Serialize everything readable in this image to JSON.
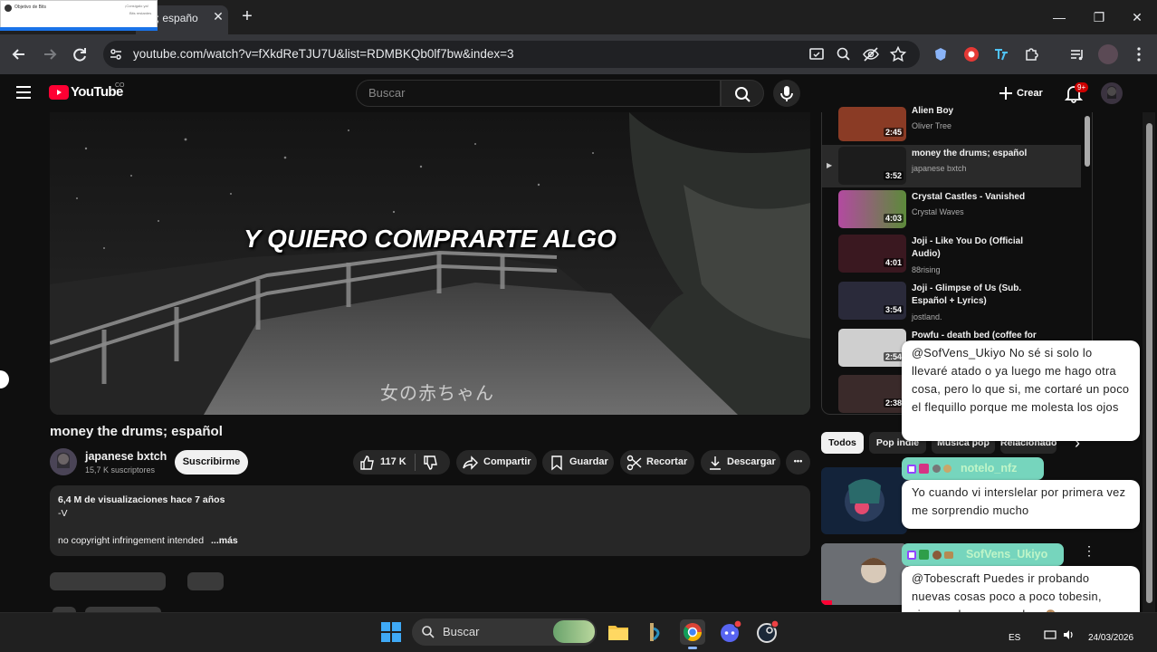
{
  "browser": {
    "tab_title": "ns; españo",
    "popup": {
      "title": "Objetivo de Bits",
      "r1": "¡Consígalo ya!",
      "r2": "Bits restantes"
    },
    "url": "youtube.com/watch?v=fXkdReTJU7U&list=RDMBKQb0lf7bw&index=3",
    "tab_close_glyph": "✕",
    "new_tab_glyph": "+",
    "window_controls": {
      "minimize": "—",
      "restore": "❐",
      "close": "✕"
    }
  },
  "header": {
    "logo_text": "YouTube",
    "country": "CO",
    "search_placeholder": "Buscar",
    "create_label": "Crear",
    "notifications_badge": "9+"
  },
  "player": {
    "subtitle": "Y QUIERO COMPRARTE ALGO",
    "jp_caption": "女の赤ちゃん"
  },
  "video": {
    "title": "money the drums; español",
    "channel": "japanese bxtch",
    "subscribers": "15,7 K suscriptores",
    "subscribe_label": "Suscribirme",
    "likes": "117 K",
    "share_label": "Compartir",
    "save_label": "Guardar",
    "clip_label": "Recortar",
    "download_label": "Descargar",
    "more_glyph": "•••"
  },
  "description": {
    "stats": "6,4 M de visualizaciones  hace 7 años",
    "line2": "-V",
    "line3": "no copyright infringement intended",
    "more": "...más"
  },
  "playlist": {
    "items": [
      {
        "title": "Alien Boy",
        "channel": "Oliver Tree",
        "duration": "2:45",
        "thumb": "#8a3b25"
      },
      {
        "title": "money the drums; español",
        "channel": "japanese bxtch",
        "duration": "3:52",
        "thumb": "#1c1c1c",
        "playing_glyph": "▶"
      },
      {
        "title": "Crystal Castles - Vanished",
        "channel": "Crystal Waves",
        "duration": "4:03",
        "thumb": "#5c8a3a"
      },
      {
        "title": "Joji - Like You Do (Official Audio)",
        "channel": "88rising",
        "duration": "4:01",
        "thumb": "#3a1820"
      },
      {
        "title": "Joji - Glimpse of Us (Sub. Español + Lyrics)",
        "channel": "jostland.",
        "duration": "3:54",
        "thumb": "#2a2a3a"
      },
      {
        "title": "Powfu - death bed (coffee for",
        "channel": "",
        "duration": "2:54",
        "thumb": "#cfcfcf"
      },
      {
        "title": "",
        "channel": "",
        "duration": "2:38",
        "thumb": "#3a2a2a"
      }
    ]
  },
  "chips": [
    "Todos",
    "Pop indie",
    "Música pop",
    "Relacionado"
  ],
  "chips_next_glyph": "›",
  "recommended": {
    "more_glyph": "⋮"
  },
  "chat": {
    "msg1": "@SofVens_Ukiyo No sé si solo lo llevaré atado o ya luego me hago otra cosa, pero lo que si, me cortaré un poco el flequillo porque me molesta los ojos",
    "msg2_name": "notelo_nfz",
    "msg2": "Yo cuando vi interslelar por primera vez me sorprendio mucho",
    "msg3_name": "SofVens_Ukiyo",
    "msg3": "@Tobescraft Puedes ir probando nuevas cosas poco a poco tobesin, siempre hay que probar 🙈"
  },
  "taskbar": {
    "search_label": "Buscar",
    "language": "ES",
    "date": "24/03/2026"
  },
  "colors": {
    "accent": "#ff0033",
    "chat_tag": "#76d5bd",
    "background": "#0f0f0f"
  }
}
